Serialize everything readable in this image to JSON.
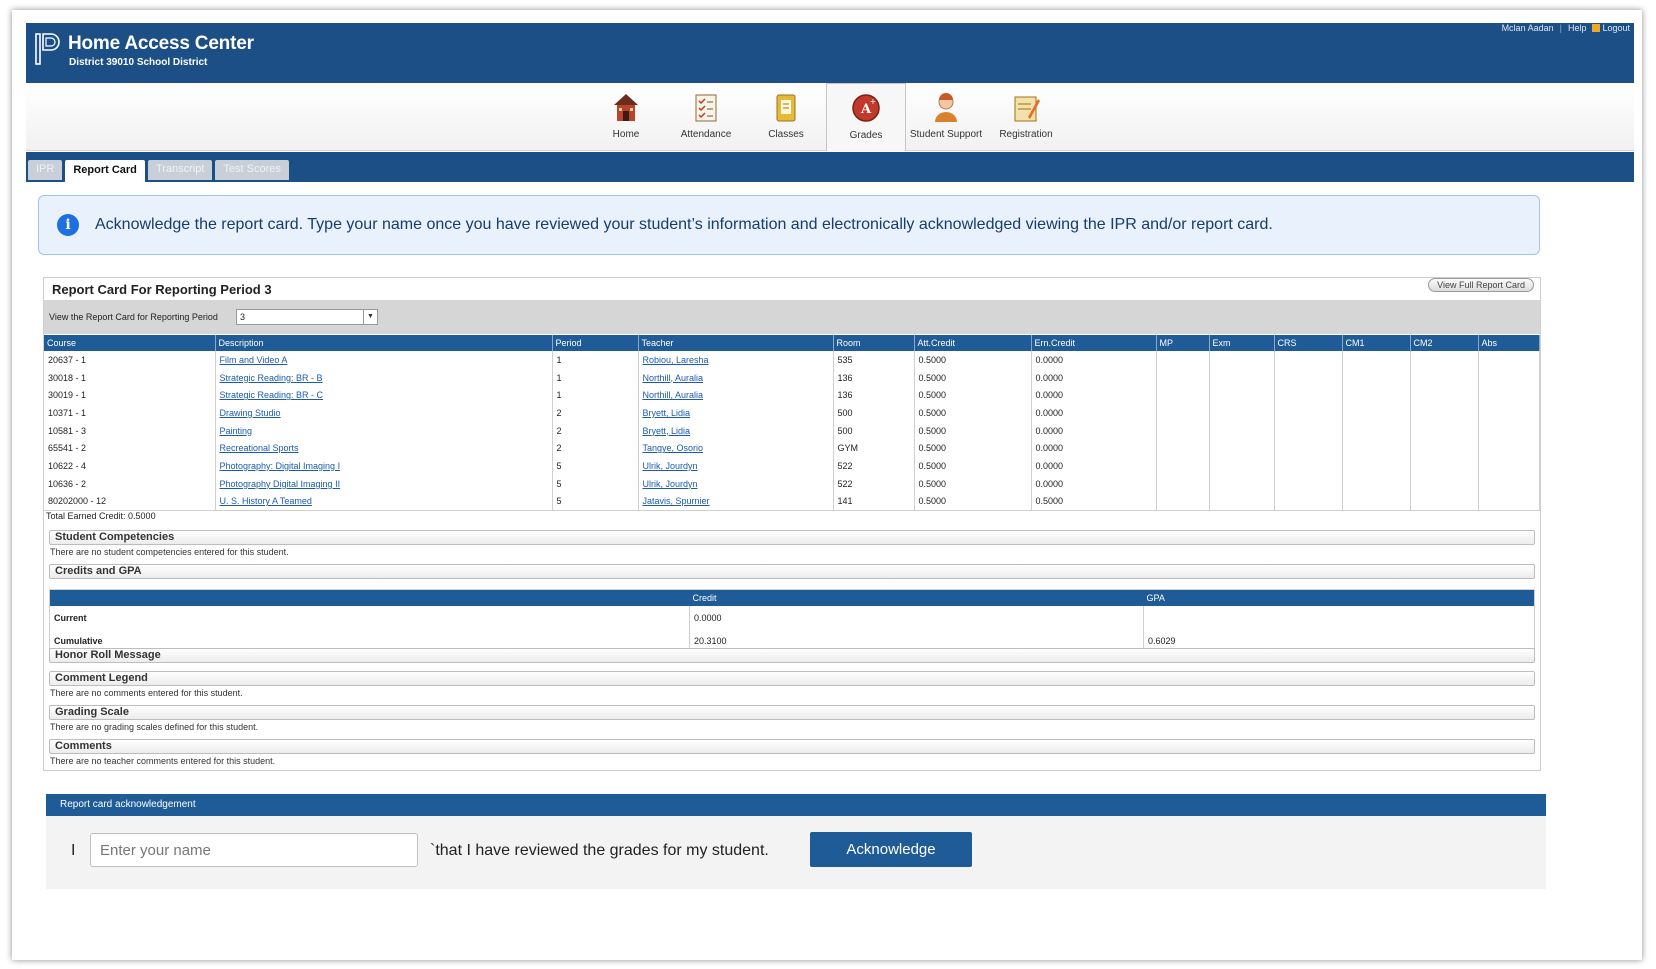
{
  "header": {
    "title": "Home Access Center",
    "district": "District 39010 School District",
    "user_name": "Mclan Aadan",
    "help": "Help",
    "logout": "Logout"
  },
  "nav": [
    {
      "label": "Home",
      "icon": "home-icon"
    },
    {
      "label": "Attendance",
      "icon": "attendance-icon"
    },
    {
      "label": "Classes",
      "icon": "classes-icon"
    },
    {
      "label": "Grades",
      "icon": "grades-icon",
      "active": true
    },
    {
      "label": "Student Support",
      "icon": "student-support-icon"
    },
    {
      "label": "Registration",
      "icon": "registration-icon"
    }
  ],
  "tabs": [
    {
      "label": "IPR"
    },
    {
      "label": "Report Card",
      "active": true
    },
    {
      "label": "Transcript"
    },
    {
      "label": "Test Scores"
    }
  ],
  "alert": {
    "icon": "info-icon",
    "text": "Acknowledge the report card. Type your name once you have reviewed your student’s information and electronically acknowledged viewing the IPR and/or report card."
  },
  "report_card": {
    "title": "Report Card For Reporting Period 3",
    "view_full_label": "View Full Report Card",
    "period_label": "View the Report Card for Reporting Period",
    "period_value": "3",
    "columns": [
      "Course",
      "Description",
      "Period",
      "Teacher",
      "Room",
      "Att.Credit",
      "Ern.Credit",
      "MP",
      "Exm",
      "CRS",
      "CM1",
      "CM2",
      "Abs"
    ],
    "rows": [
      [
        "20637 - 1",
        "Film and Video A",
        "1",
        "Robiou, Laresha",
        "535",
        "0.5000",
        "0.0000"
      ],
      [
        "30018 - 1",
        "Strategic Reading: BR - B",
        "1",
        "Northill, Auralia",
        "136",
        "0.5000",
        "0.0000"
      ],
      [
        "30019 - 1",
        "Strategic Reading: BR - C",
        "1",
        "Northill, Auralia",
        "136",
        "0.5000",
        "0.0000"
      ],
      [
        "10371 - 1",
        "Drawing Studio",
        "2",
        "Bryett, Lidia",
        "500",
        "0.5000",
        "0.0000"
      ],
      [
        "10581 - 3",
        "Painting",
        "2",
        "Bryett, Lidia",
        "500",
        "0.5000",
        "0.0000"
      ],
      [
        "65541 - 2",
        "Recreational Sports",
        "2",
        "Tangye, Osorio",
        "GYM",
        "0.5000",
        "0.0000"
      ],
      [
        "10622 - 4",
        "Photography: Digital Imaging I",
        "5",
        "Ulrik, Jourdyn",
        "522",
        "0.5000",
        "0.0000"
      ],
      [
        "10636 - 2",
        "Photography Digital Imaging II",
        "5",
        "Ulrik, Jourdyn",
        "522",
        "0.5000",
        "0.0000"
      ],
      [
        "80202000 - 12",
        "U. S. History A Teamed",
        "5",
        "Jatavis, Spurnier",
        "141",
        "0.5000",
        "0.5000"
      ]
    ],
    "total_earned": "Total Earned Credit: 0.5000"
  },
  "sections": {
    "competencies_title": "Student Competencies",
    "competencies_note": "There are no student competencies entered for this student.",
    "gpa_title": "Credits and GPA",
    "gpa_columns": [
      "",
      "Credit",
      "GPA"
    ],
    "gpa_rows": [
      [
        "Current",
        "0.0000",
        ""
      ],
      [
        "Cumulative",
        "20.3100",
        "0.6029"
      ]
    ],
    "honor_title": "Honor Roll Message",
    "legend_title": "Comment Legend",
    "legend_note": "There are no comments entered for this student.",
    "scale_title": "Grading Scale",
    "scale_note": "There are no grading scales defined for this student.",
    "comments_title": "Comments",
    "comments_note": "There are no teacher comments entered for this student."
  },
  "acknowledgement": {
    "header": "Report card acknowledgement",
    "prefix": "I",
    "placeholder": "Enter your name",
    "text": "`that I have reviewed the grades for my student.",
    "button": "Acknowledge"
  }
}
